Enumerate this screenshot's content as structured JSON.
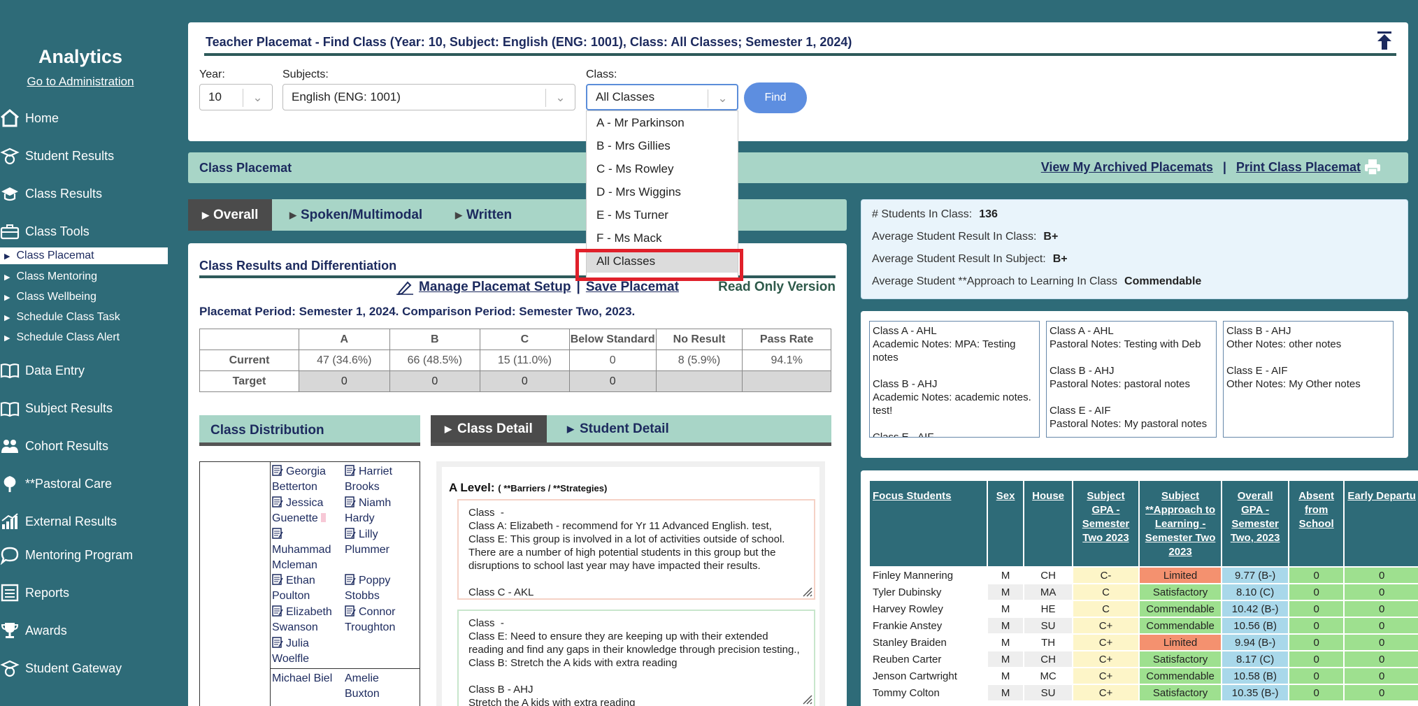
{
  "sidebar": {
    "title": "Analytics",
    "admin_link": "Go to Administration",
    "items": [
      {
        "label": "Home",
        "icon": "home-icon"
      },
      {
        "label": "Student Results",
        "icon": "student-results-icon"
      },
      {
        "label": "Class Results",
        "icon": "class-results-icon"
      },
      {
        "label": "Class Tools",
        "icon": "class-tools-icon"
      },
      {
        "label": "Data Entry",
        "icon": "data-entry-icon"
      },
      {
        "label": "Subject Results",
        "icon": "subject-results-icon"
      },
      {
        "label": "Cohort Results",
        "icon": "cohort-results-icon"
      },
      {
        "label": "**Pastoral Care",
        "icon": "pastoral-care-icon"
      },
      {
        "label": "External Results",
        "icon": "external-results-icon"
      },
      {
        "label": "Mentoring Program",
        "icon": "mentoring-icon"
      },
      {
        "label": "Reports",
        "icon": "reports-icon"
      },
      {
        "label": "Awards",
        "icon": "awards-icon"
      },
      {
        "label": "Student Gateway",
        "icon": "student-gateway-icon"
      }
    ],
    "sub_items": [
      "Class Placemat",
      "Class Mentoring",
      "Class Wellbeing",
      "Schedule Class Task",
      "Schedule Class Alert"
    ]
  },
  "header": {
    "title": "Teacher Placemat - Find Class (Year: 10, Subject: English (ENG: 1001), Class: All Classes; Semester 1, 2024)",
    "year_label": "Year:",
    "year_value": "10",
    "subjects_label": "Subjects:",
    "subjects_value": "English (ENG: 1001)",
    "class_label": "Class:",
    "class_value": "All Classes",
    "find_label": "Find"
  },
  "class_dropdown": {
    "options": [
      "A - Mr Parkinson",
      "B - Mrs Gillies",
      "C - Ms Rowley",
      "D - Mrs Wiggins",
      "E - Ms Turner",
      "F - Ms Mack",
      "All Classes"
    ],
    "selected": "All Classes"
  },
  "placemat_bar": {
    "title": "Class Placemat",
    "archived_link": "View My Archived Placemats",
    "separator": "|",
    "print_link": "Print Class Placemat"
  },
  "tabs": {
    "overall": "Overall",
    "spoken": "Spoken/Multimodal",
    "written": "Written"
  },
  "results": {
    "title": "Class Results and Differentiation",
    "manage_link": "Manage Placemat Setup",
    "separator": "|",
    "save_link": "Save Placemat",
    "read_only": "Read Only Version",
    "period": "Placemat Period: Semester 1, 2024. Comparison Period: Semester Two, 2023.",
    "columns": [
      "A",
      "B",
      "C",
      "Below Standard",
      "No Result",
      "Pass Rate"
    ],
    "current_label": "Current",
    "current": [
      "47 (34.6%)",
      "66 (48.5%)",
      "15 (11.0%)",
      "0",
      "8 (5.9%)",
      "94.1%"
    ],
    "target_label": "Target",
    "target": [
      "0",
      "0",
      "0",
      "0",
      "",
      ""
    ]
  },
  "distribution": {
    "title": "Class Distribution",
    "students": [
      "Georgia Betterton",
      "Harriet Brooks",
      "Jessica Guenette",
      "Niamh Hardy",
      "Muhammad Mcleman",
      "Lilly Plummer",
      "Ethan Poulton",
      "Poppy Stobbs",
      "Elizabeth Swanson",
      "Connor Troughton",
      "Julia Woelfle",
      "Michael Biel",
      "Amelie Buxton"
    ]
  },
  "detail": {
    "class_tab": "Class Detail",
    "student_tab": "Student Detail",
    "level_label": "A Level:",
    "level_legend": "( **Barriers / **Strategies)",
    "note1": "Class  -\nClass A: Elizabeth - recommend for Yr 11 Advanced English. test,\nClass E: This group is involved in a lot of activities outside of school. There are a number of high potential students in this group but the disruptions to school last year may have impacted their results.\n\nClass C - AKL",
    "note2": "Class  -\nClass E: Need to ensure they are keeping up with their extended reading and find any gaps in their knowledge through precision testing., Class B: Stretch the A kids with extra reading\n\nClass B - AHJ\nStretch the A kids with extra reading"
  },
  "stats": {
    "students_label": "# Students In Class:",
    "students_value": "136",
    "avg_class_label": "Average Student Result In Class:",
    "avg_class_value": "B+",
    "avg_subject_label": "Average Student Result In Subject:",
    "avg_subject_value": "B+",
    "approach_label": "Average Student **Approach to Learning In Class",
    "approach_value": "Commendable"
  },
  "notes": {
    "academic": "Class A - AHL\nAcademic Notes: MPA: Testing notes\n\nClass B - AHJ\nAcademic Notes: academic notes. test!\n\nClass E - AIF",
    "pastoral": "Class A - AHL\nPastoral Notes: Testing with Deb\n\nClass B - AHJ\nPastoral Notes: pastoral notes\n\nClass E - AIF\nPastoral Notes: My pastoral notes",
    "other": "Class B - AHJ\nOther Notes: other notes\n\nClass E - AIF\nOther Notes: My Other notes"
  },
  "focus": {
    "headers": [
      "Focus Students",
      "Sex",
      "House",
      "Subject GPA - Semester Two 2023",
      "Subject **Approach to Learning - Semester Two 2023",
      "Overall GPA - Semester Two, 2023",
      "Absent from School",
      "Early Departure"
    ],
    "header_shown": [
      "Focus Students",
      "Sex",
      "House",
      "Subject GPA - Semester Two 2023",
      "Subject **Approach to Learning - Semester Two 2023",
      "Overall GPA - Semester Two, 2023",
      "Absent from School",
      "Early Departu"
    ],
    "rows": [
      [
        "Finley Mannering",
        "M",
        "CH",
        "C-",
        "Limited",
        "9.77 (B-)",
        "0",
        "0"
      ],
      [
        "Tyler Dubinsky",
        "M",
        "MA",
        "C",
        "Satisfactory",
        "8.10 (C)",
        "0",
        "0"
      ],
      [
        "Harvey Rowley",
        "M",
        "HE",
        "C",
        "Commendable",
        "10.42 (B-)",
        "0",
        "0"
      ],
      [
        "Frankie Anstey",
        "M",
        "SU",
        "C+",
        "Commendable",
        "10.56 (B)",
        "0",
        "0"
      ],
      [
        "Stanley Braiden",
        "M",
        "TH",
        "C+",
        "Limited",
        "9.94 (B-)",
        "0",
        "0"
      ],
      [
        "Reuben Carter",
        "M",
        "CH",
        "C+",
        "Satisfactory",
        "8.17 (C)",
        "0",
        "0"
      ],
      [
        "Jenson Cartwright",
        "M",
        "MC",
        "C+",
        "Commendable",
        "10.58 (B)",
        "0",
        "0"
      ],
      [
        "Tommy Colton",
        "M",
        "SU",
        "C+",
        "Satisfactory",
        "10.35 (B-)",
        "0",
        "0"
      ]
    ]
  },
  "colors": {
    "background": "#2e6b78",
    "accent_bar": "#a8d5c7",
    "limited": "#f4916f",
    "approach_ok": "#9ee08f",
    "gpa": "#a9d8ea",
    "subject_gpa": "#fdf5c8",
    "highlight": "#e0202a"
  }
}
